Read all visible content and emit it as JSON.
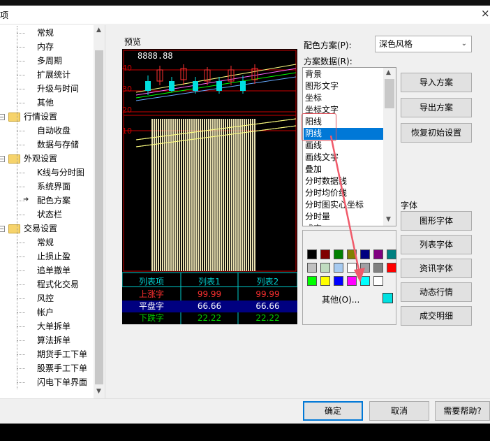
{
  "window": {
    "title": "选项",
    "close": "×"
  },
  "tree": {
    "items": [
      {
        "label": "常规",
        "level": 2
      },
      {
        "label": "内存",
        "level": 2
      },
      {
        "label": "多周期",
        "level": 2
      },
      {
        "label": "扩展统计",
        "level": 2
      },
      {
        "label": "升级与时间",
        "level": 2
      },
      {
        "label": "其他",
        "level": 2
      },
      {
        "label": "行情设置",
        "level": 1
      },
      {
        "label": "自动收盘",
        "level": 2
      },
      {
        "label": "数据与存储",
        "level": 2
      },
      {
        "label": "外观设置",
        "level": 1
      },
      {
        "label": "K线与分时图",
        "level": 2
      },
      {
        "label": "系统界面",
        "level": 2
      },
      {
        "label": "配色方案",
        "level": 2,
        "selected": true
      },
      {
        "label": "状态栏",
        "level": 2
      },
      {
        "label": "交易设置",
        "level": 1
      },
      {
        "label": "常规",
        "level": 2
      },
      {
        "label": "止损止盈",
        "level": 2
      },
      {
        "label": "追单撤单",
        "level": 2
      },
      {
        "label": "程式化交易",
        "level": 2
      },
      {
        "label": "风控",
        "level": 2
      },
      {
        "label": "帐户",
        "level": 2
      },
      {
        "label": "大单拆单",
        "level": 2
      },
      {
        "label": "算法拆单",
        "level": 2
      },
      {
        "label": "期货手工下单",
        "level": 2
      },
      {
        "label": "股票手工下单",
        "level": 2
      },
      {
        "label": "闪电下单界面",
        "level": 2
      }
    ]
  },
  "preview": {
    "label": "预览",
    "price": "8888.88",
    "axis": [
      "40",
      "30",
      "20",
      "10"
    ],
    "table": {
      "headers": [
        "列表项",
        "列表1",
        "列表2"
      ],
      "rows": [
        {
          "name": "上涨字",
          "v1": "99.99",
          "v2": "99.99",
          "color": "#ff3030"
        },
        {
          "name": "平盘字",
          "v1": "66.66",
          "v2": "66.66",
          "color": "#ffffff"
        },
        {
          "name": "下跌字",
          "v1": "22.22",
          "v2": "22.22",
          "color": "#00cc00"
        }
      ]
    }
  },
  "scheme": {
    "label": "配色方案(P):",
    "value": "深色风格",
    "data_label": "方案数据(R):",
    "data_items": [
      "背景",
      "图形文字",
      "坐标",
      "坐标文字",
      "阳线",
      "阴线",
      "画线",
      "画线文字",
      "叠加",
      "分时数据线",
      "分时均价线",
      "分时图实心坐标",
      "分时量",
      "成交"
    ],
    "selected_index": 5
  },
  "palette": {
    "colors": [
      "#000000",
      "#800000",
      "#008000",
      "#808000",
      "#000080",
      "#800080",
      "#008080",
      "#c0c0c0",
      "#c0dcc0",
      "#a6caf0",
      "#ffffff",
      "#a0a0a4",
      "#808080",
      "#ff0000",
      "#00ff00",
      "#ffff00",
      "#0000ff",
      "#ff00ff",
      "#00ffff",
      "#ffffff"
    ],
    "other_label": "其他(O)...",
    "current": "#00e0e0"
  },
  "buttons": {
    "import": "导入方案",
    "export": "导出方案",
    "restore": "恢复初始设置",
    "font_label": "字体",
    "chart_font": "图形字体",
    "list_font": "列表字体",
    "news_font": "资讯字体",
    "dynamic": "动态行情",
    "trade_detail": "成交明细",
    "ok": "确定",
    "cancel": "取消",
    "help": "需要帮助?"
  }
}
